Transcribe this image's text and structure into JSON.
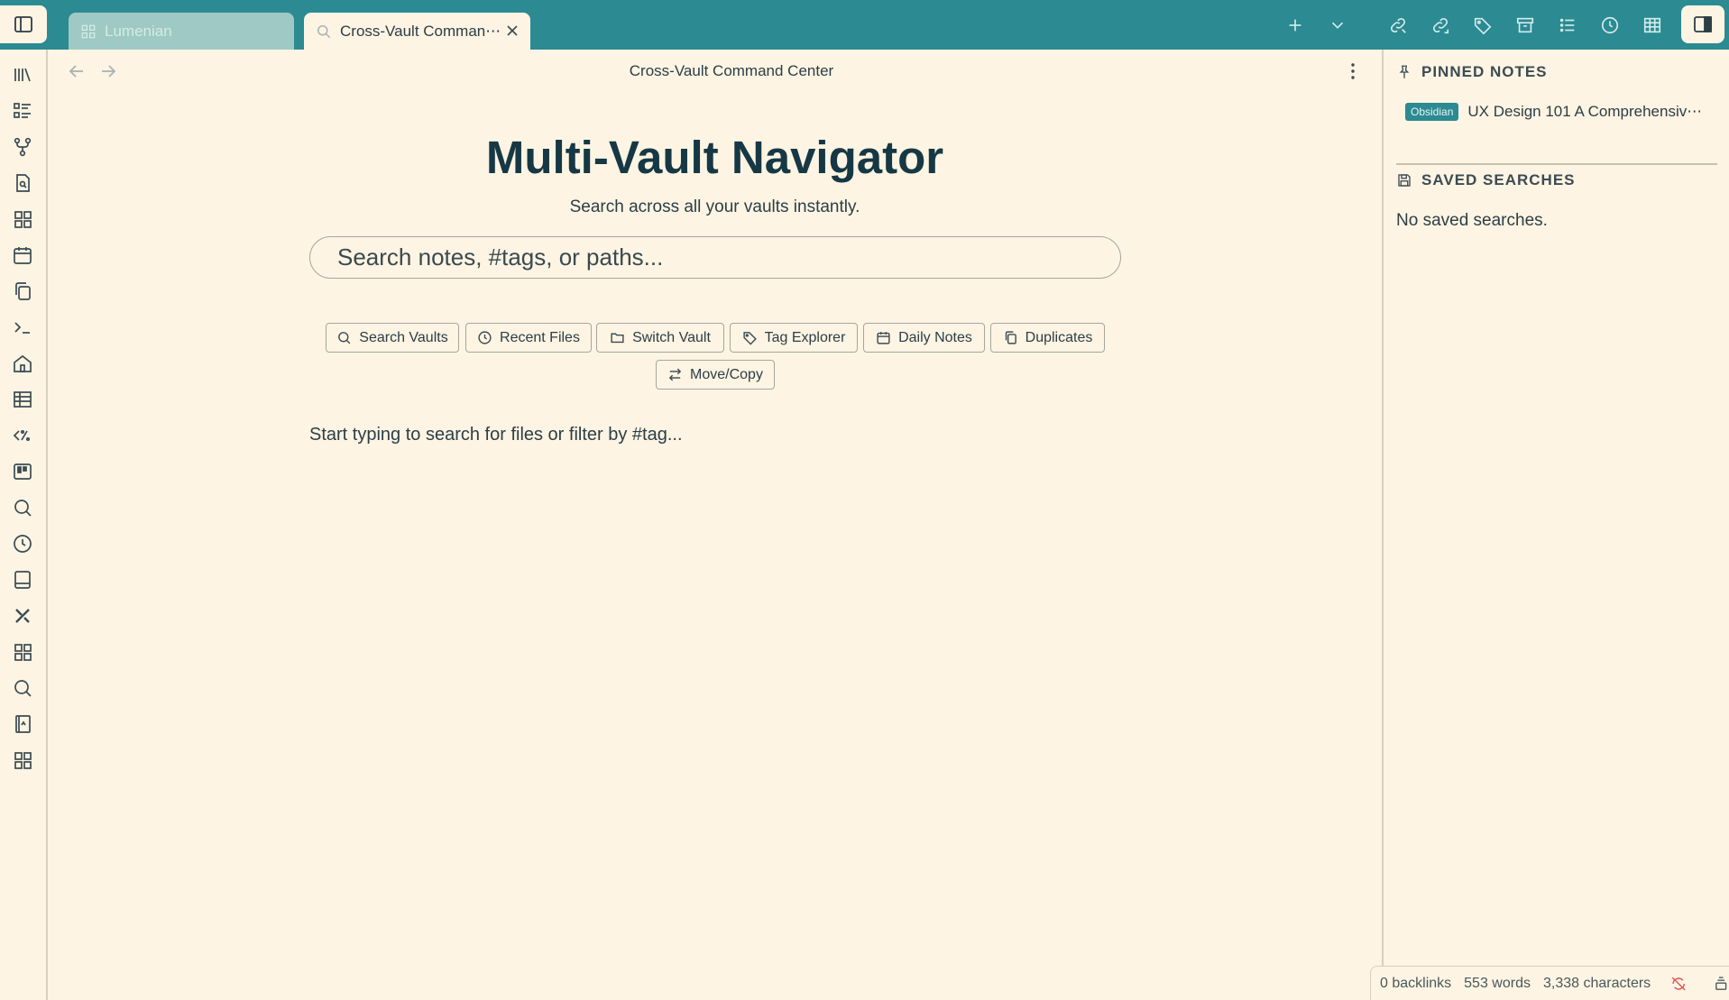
{
  "tabs": [
    {
      "label": "Lumenian",
      "icon": "grid-icon",
      "active": false
    },
    {
      "label": "Cross-Vault Comman⋯",
      "icon": "search-icon",
      "active": true
    }
  ],
  "view": {
    "title": "Cross-Vault Command Center"
  },
  "main": {
    "heading": "Multi-Vault Navigator",
    "subheading": "Search across all your vaults instantly.",
    "search_placeholder": "Search notes, #tags, or paths...",
    "buttons": [
      {
        "label": "Search Vaults",
        "icon": "search-icon"
      },
      {
        "label": "Recent Files",
        "icon": "clock-icon"
      },
      {
        "label": "Switch Vault",
        "icon": "folder-icon"
      },
      {
        "label": "Tag Explorer",
        "icon": "tag-icon"
      },
      {
        "label": "Daily Notes",
        "icon": "calendar-icon"
      },
      {
        "label": "Duplicates",
        "icon": "copy-icon"
      },
      {
        "label": "Move/Copy",
        "icon": "swap-icon"
      }
    ],
    "hint": "Start typing to search for files or filter by #tag..."
  },
  "sidebar": {
    "pinned_header": "PINNED NOTES",
    "pinned_items": [
      {
        "badge": "Obsidian",
        "title": "UX Design 101 A Comprehensiv⋯"
      }
    ],
    "saved_header": "SAVED SEARCHES",
    "saved_empty": "No saved searches."
  },
  "status": {
    "backlinks": "0 backlinks",
    "words": "553 words",
    "characters": "3,338 characters"
  },
  "colors": {
    "accent": "#2b8a92",
    "background": "#fdf4e3",
    "heading": "#163844",
    "sync_error": "#e05252"
  }
}
